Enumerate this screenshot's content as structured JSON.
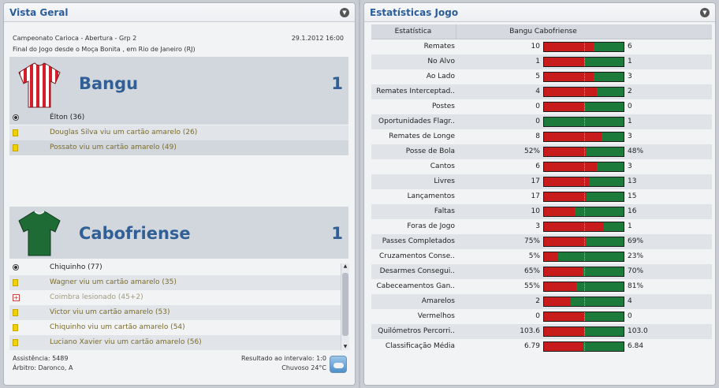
{
  "overview": {
    "title": "Vista Geral",
    "competition": "Campeonato Carioca - Abertura - Grp 2",
    "datetime": "29.1.2012 16:00",
    "venue": "Final do Jogo desde o Moça Bonita , em Rio de Janeiro (RJ)",
    "home": {
      "name": "Bangu",
      "score": "1",
      "shirt_colors": [
        "#d21f2b",
        "#ffffff"
      ],
      "events": [
        {
          "type": "goal",
          "text": "Élton (36)"
        },
        {
          "type": "yellow",
          "text": "Douglas Silva viu um cartão amarelo (26)"
        },
        {
          "type": "yellow",
          "text": "Possato viu um cartão amarelo (49)"
        }
      ]
    },
    "away": {
      "name": "Cabofriense",
      "score": "1",
      "shirt_colors": [
        "#1e6b36",
        "#ffffff"
      ],
      "events": [
        {
          "type": "goal",
          "text": "Chiquinho (77)"
        },
        {
          "type": "yellow",
          "text": "Wagner viu um cartão amarelo (35)"
        },
        {
          "type": "injury",
          "text": "Coimbra lesionado (45+2)"
        },
        {
          "type": "yellow",
          "text": "Victor viu um cartão amarelo (53)"
        },
        {
          "type": "yellow",
          "text": "Chiquinho viu um cartão amarelo (54)"
        },
        {
          "type": "yellow",
          "text": "Luciano Xavier viu um cartão amarelo (56)"
        }
      ]
    },
    "attendance": "Assistência: 5489",
    "referee": "Árbitro: Daronco, A",
    "halftime": "Resultado ao intervalo: 1:0",
    "weather": "Chuvoso 24°C"
  },
  "stats": {
    "title": "Estatísticas Jogo",
    "header_stat": "Estatística",
    "header_teams": "Bangu Cabofriense",
    "colors": {
      "home": "#c81c1c",
      "away": "#1c7a3a"
    },
    "rows": [
      {
        "label": "Remates",
        "home": "10",
        "away": "6",
        "home_share": 0.625
      },
      {
        "label": "No Alvo",
        "home": "1",
        "away": "1",
        "home_share": 0.5
      },
      {
        "label": "Ao Lado",
        "home": "5",
        "away": "3",
        "home_share": 0.625
      },
      {
        "label": "Remates Interceptad..",
        "home": "4",
        "away": "2",
        "home_share": 0.667
      },
      {
        "label": "Postes",
        "home": "0",
        "away": "0",
        "home_share": 0.5
      },
      {
        "label": "Oportunidades Flagr..",
        "home": "0",
        "away": "1",
        "home_share": 0.0
      },
      {
        "label": "Remates de Longe",
        "home": "8",
        "away": "3",
        "home_share": 0.727
      },
      {
        "label": "Posse de Bola",
        "home": "52%",
        "away": "48%",
        "home_share": 0.52
      },
      {
        "label": "Cantos",
        "home": "6",
        "away": "3",
        "home_share": 0.667
      },
      {
        "label": "Livres",
        "home": "17",
        "away": "13",
        "home_share": 0.567
      },
      {
        "label": "Lançamentos",
        "home": "17",
        "away": "15",
        "home_share": 0.531
      },
      {
        "label": "Faltas",
        "home": "10",
        "away": "16",
        "home_share": 0.385
      },
      {
        "label": "Foras de Jogo",
        "home": "3",
        "away": "1",
        "home_share": 0.75
      },
      {
        "label": "Passes Completados",
        "home": "75%",
        "away": "69%",
        "home_share": 0.521
      },
      {
        "label": "Cruzamentos Conse..",
        "home": "5%",
        "away": "23%",
        "home_share": 0.179
      },
      {
        "label": "Desarmes Consegui..",
        "home": "65%",
        "away": "70%",
        "home_share": 0.481
      },
      {
        "label": "Cabeceamentos Gan..",
        "home": "55%",
        "away": "81%",
        "home_share": 0.404
      },
      {
        "label": "Amarelos",
        "home": "2",
        "away": "4",
        "home_share": 0.333
      },
      {
        "label": "Vermelhos",
        "home": "0",
        "away": "0",
        "home_share": 0.5
      },
      {
        "label": "Quilómetros Percorri..",
        "home": "103.6",
        "away": "103.0",
        "home_share": 0.501
      },
      {
        "label": "Classificação Média",
        "home": "6.79",
        "away": "6.84",
        "home_share": 0.498
      }
    ]
  }
}
